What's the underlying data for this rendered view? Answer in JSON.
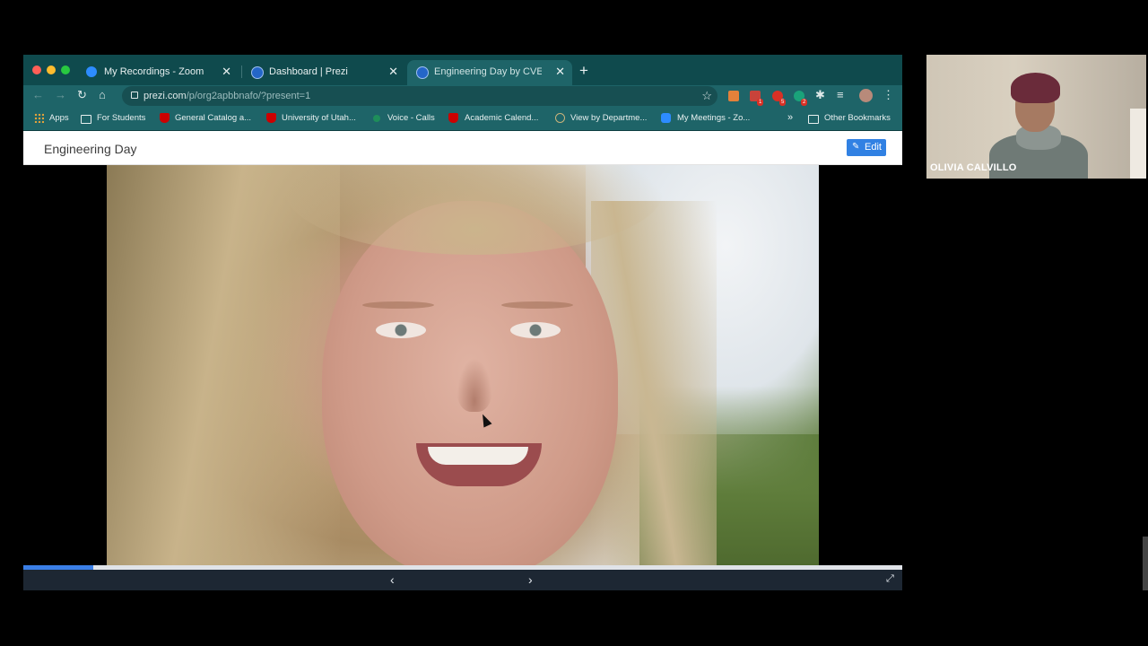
{
  "browser": {
    "tabs": [
      {
        "title": "My Recordings - Zoom",
        "favicon": "zoom-icon"
      },
      {
        "title": "Dashboard | Prezi",
        "favicon": "prezi-icon"
      },
      {
        "title": "Engineering Day by CVEEN",
        "favicon": "prezi-icon",
        "active": true
      }
    ],
    "url": {
      "host": "prezi.com",
      "path": "/p/org2apbbnafo/?present=1"
    },
    "extension_badges": [
      "1",
      "5",
      "2"
    ],
    "bookmarks": [
      {
        "label": "Apps",
        "icon": "apps-grid-icon"
      },
      {
        "label": "For Students",
        "icon": "folder-icon"
      },
      {
        "label": "General Catalog a...",
        "icon": "university-u-icon"
      },
      {
        "label": "University of Utah...",
        "icon": "university-u-icon"
      },
      {
        "label": "Voice - Calls",
        "icon": "voice-icon"
      },
      {
        "label": "Academic Calend...",
        "icon": "university-u-icon"
      },
      {
        "label": "View by Departme...",
        "icon": "globe-icon"
      },
      {
        "label": "My Meetings - Zo...",
        "icon": "zoom-icon"
      }
    ],
    "bookmarks_more": "»",
    "other_bookmarks": "Other Bookmarks"
  },
  "prezi": {
    "title": "Engineering Day",
    "edit_label": "Edit",
    "progress_percent": 8
  },
  "participant": {
    "name": "OLIVIA CALVILLO"
  },
  "colors": {
    "tabstrip": "#0f4a4d",
    "toolbar": "#1e6468",
    "edit_button": "#3181e3",
    "progress": "#3a7ee6",
    "controls": "#1d2733"
  }
}
